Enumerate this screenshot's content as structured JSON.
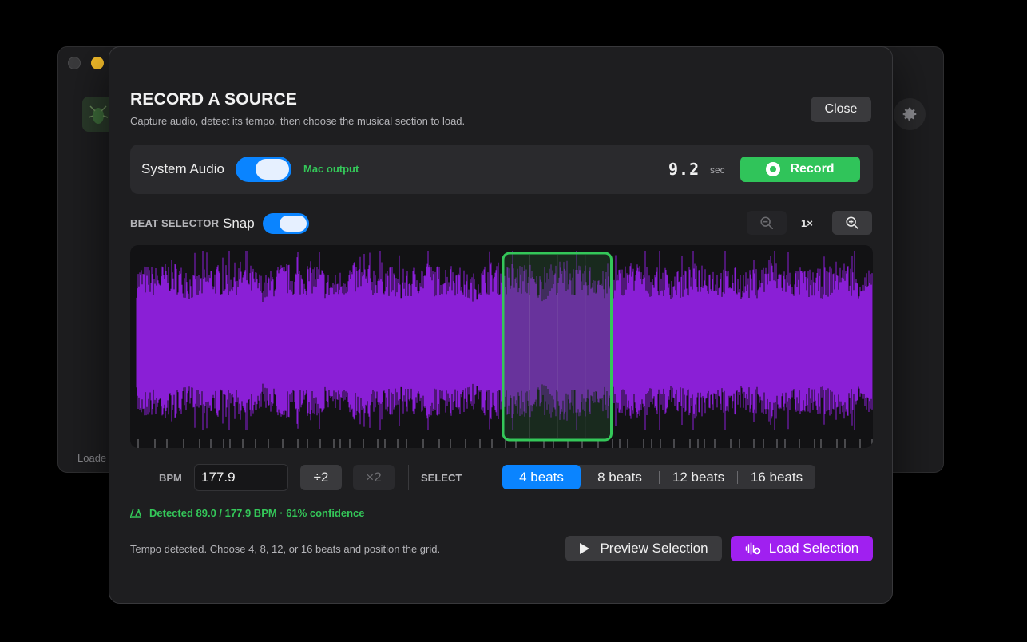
{
  "background_window": {
    "loaded_label": "Loade"
  },
  "dialog": {
    "title": "RECORD A SOURCE",
    "subtitle": "Capture audio, detect its tempo, then choose the musical section to load.",
    "close_label": "Close"
  },
  "source": {
    "label": "System Audio",
    "toggle_on": true,
    "output_label": "Mac output",
    "duration": "9.2",
    "duration_unit": "sec",
    "record_label": "Record"
  },
  "beat_selector": {
    "label": "BEAT SELECTOR",
    "snap_label": "Snap",
    "snap_on": true,
    "zoom_level": "1×"
  },
  "waveform": {
    "color": "#8a1fd6",
    "selection_color": "#34c759",
    "selection_start_fraction": 0.5,
    "selection_end_fraction": 0.65
  },
  "tempo": {
    "bpm_label": "BPM",
    "bpm_value": "177.9",
    "halve_label": "÷2",
    "double_label": "×2",
    "select_label": "SELECT",
    "beat_options": [
      "4 beats",
      "8 beats",
      "12 beats",
      "16 beats"
    ],
    "active_option": 0,
    "detected_text": "Detected 89.0 / 177.9 BPM · 61% confidence"
  },
  "footer": {
    "hint": "Tempo detected. Choose 4, 8, 12, or 16 beats and position the grid.",
    "preview_label": "Preview Selection",
    "load_label": "Load Selection"
  },
  "colors": {
    "accent_blue": "#0a84ff",
    "record_green": "#30c45a",
    "load_purple": "#a020f0"
  }
}
